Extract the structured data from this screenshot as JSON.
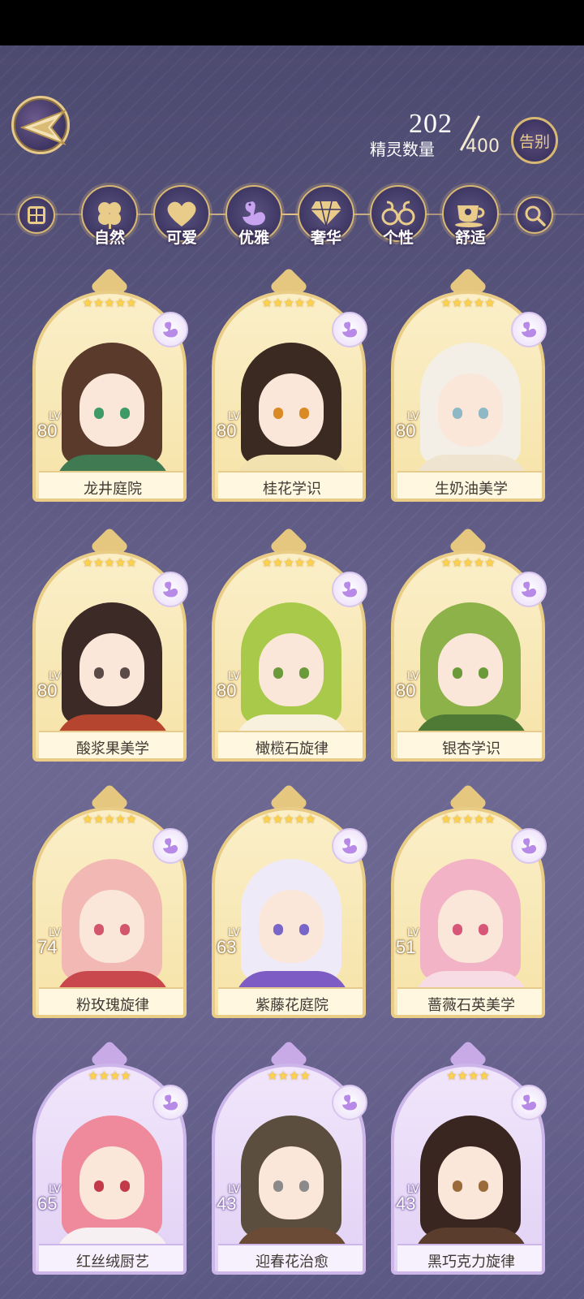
{
  "header": {
    "count_current": "202",
    "count_label": "精灵数量",
    "count_max": "400",
    "farewell_label": "告别"
  },
  "filters": [
    {
      "id": "all",
      "label": "",
      "icon": "gift-grid-icon"
    },
    {
      "id": "nature",
      "label": "自然",
      "icon": "clover-icon"
    },
    {
      "id": "cute",
      "label": "可爱",
      "icon": "heart-icon"
    },
    {
      "id": "elegant",
      "label": "优雅",
      "icon": "swan-icon",
      "selected": true
    },
    {
      "id": "luxury",
      "label": "奢华",
      "icon": "diamond-icon"
    },
    {
      "id": "personality",
      "label": "个性",
      "icon": "glasses-icon"
    },
    {
      "id": "comfort",
      "label": "舒适",
      "icon": "teacup-icon"
    },
    {
      "id": "search",
      "label": "",
      "icon": "search-icon"
    }
  ],
  "cards": [
    {
      "name": "龙井庭院",
      "lv_label": "LV",
      "level": "80",
      "stars": "★★★★★",
      "theme": "gold",
      "hair": "#5a3a2a",
      "outfit": "#3f7a52",
      "eye": "#3f9a6a"
    },
    {
      "name": "桂花学识",
      "lv_label": "LV",
      "level": "80",
      "stars": "★★★★★",
      "theme": "gold",
      "hair": "#3a2a22",
      "outfit": "#f2e2b0",
      "eye": "#d98a22"
    },
    {
      "name": "生奶油美学",
      "lv_label": "LV",
      "level": "80",
      "stars": "★★★★★",
      "theme": "gold",
      "hair": "#f4efe6",
      "outfit": "#efe4cf",
      "eye": "#8fb8c6"
    },
    {
      "name": "酸浆果美学",
      "lv_label": "LV",
      "level": "80",
      "stars": "★★★★★",
      "theme": "gold",
      "hair": "#3b2a26",
      "outfit": "#b5452e",
      "eye": "#5a4a48"
    },
    {
      "name": "橄榄石旋律",
      "lv_label": "LV",
      "level": "80",
      "stars": "★★★★★",
      "theme": "gold",
      "hair": "#a9c94a",
      "outfit": "#f7f1de",
      "eye": "#6a9a3a"
    },
    {
      "name": "银杏学识",
      "lv_label": "LV",
      "level": "80",
      "stars": "★★★★★",
      "theme": "gold",
      "hair": "#8db24a",
      "outfit": "#4f7a36",
      "eye": "#6a9a3a"
    },
    {
      "name": "粉玫瑰旋律",
      "lv_label": "LV",
      "level": "74",
      "stars": "★★★★★",
      "theme": "gold",
      "hair": "#f2b9b4",
      "outfit": "#c9484e",
      "eye": "#d2576a"
    },
    {
      "name": "紫藤花庭院",
      "lv_label": "LV",
      "level": "63",
      "stars": "★★★★★",
      "theme": "gold",
      "hair": "#eeeaf7",
      "outfit": "#7d5cc4",
      "eye": "#7a66c8"
    },
    {
      "name": "蔷薇石英美学",
      "lv_label": "LV",
      "level": "51",
      "stars": "★★★★★",
      "theme": "gold",
      "hair": "#f3b3c6",
      "outfit": "#f7dce6",
      "eye": "#d6577a"
    },
    {
      "name": "红丝绒厨艺",
      "lv_label": "LV",
      "level": "65",
      "stars": "★★★★",
      "theme": "purple",
      "hair": "#ee8a9c",
      "outfit": "#f6f0f2",
      "eye": "#c23a4a"
    },
    {
      "name": "迎春花治愈",
      "lv_label": "LV",
      "level": "43",
      "stars": "★★★★",
      "theme": "purple",
      "hair": "#5b4e3e",
      "outfit": "#6b4a36",
      "eye": "#8a8a8a"
    },
    {
      "name": "黑巧克力旋律",
      "lv_label": "LV",
      "level": "43",
      "stars": "★★★★",
      "theme": "purple",
      "hair": "#3a2620",
      "outfit": "#5a3d2c",
      "eye": "#9a6a3a"
    }
  ]
}
